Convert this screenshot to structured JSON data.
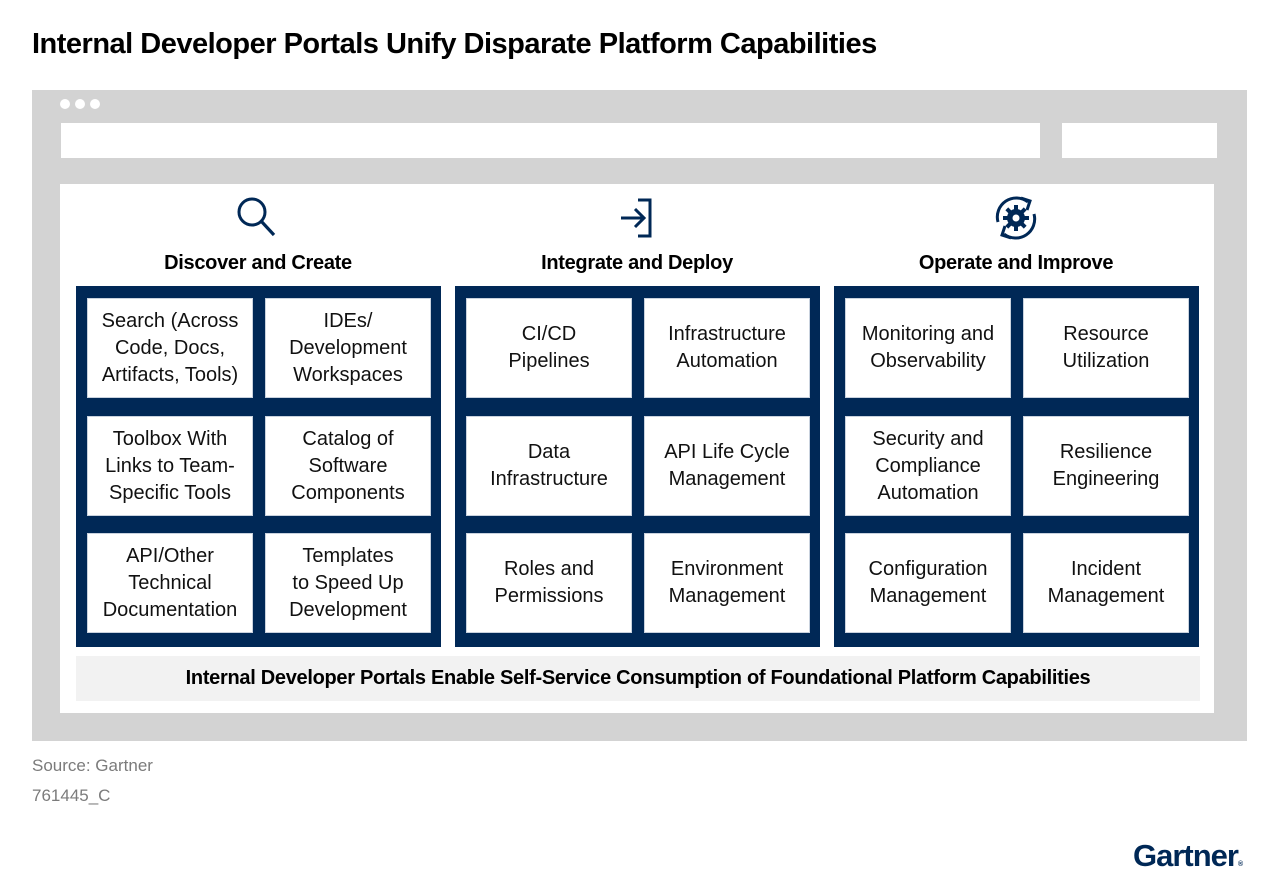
{
  "title": "Internal Developer Portals Unify Disparate Platform Capabilities",
  "colors": {
    "navy": "#002856",
    "frame_gray": "#d3d3d3",
    "bar_gray": "#f2f2f2",
    "footer_gray": "#7b7b7b"
  },
  "columns": [
    {
      "title": "Discover and Create",
      "icon": "magnifier-icon",
      "items": [
        "Search (Across\nCode, Docs,\nArtifacts, Tools)",
        "IDEs/\nDevelopment\nWorkspaces",
        "Toolbox With\nLinks to Team-\nSpecific Tools",
        "Catalog of\nSoftware\nComponents",
        "API/Other\nTechnical\nDocumentation",
        "Templates\nto Speed Up\nDevelopment"
      ]
    },
    {
      "title": "Integrate and Deploy",
      "icon": "sign-in-arrow-icon",
      "items": [
        "CI/CD\nPipelines",
        "Infrastructure\nAutomation",
        "Data\nInfrastructure",
        "API Life Cycle\nManagement",
        "Roles and\nPermissions",
        "Environment\nManagement"
      ]
    },
    {
      "title": "Operate and Improve",
      "icon": "gear-cycle-icon",
      "items": [
        "Monitoring and\nObservability",
        "Resource\nUtilization",
        "Security and\nCompliance\nAutomation",
        "Resilience\nEngineering",
        "Configuration\nManagement",
        "Incident\nManagement"
      ]
    }
  ],
  "bottom_bar": "Internal Developer Portals Enable Self-Service Consumption of Foundational Platform Capabilities",
  "footer": {
    "source": "Source: Gartner",
    "code": "761445_C",
    "logo": "Gartner"
  }
}
